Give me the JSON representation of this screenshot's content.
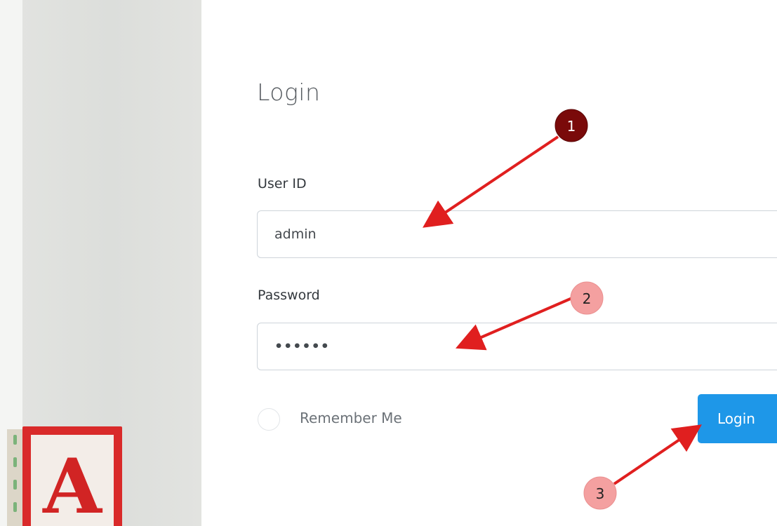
{
  "login": {
    "title": "Login",
    "user_id_label": "User ID",
    "user_id_value": "admin",
    "password_label": "Password",
    "password_mask": "••••••",
    "remember_label": "Remember Me",
    "submit_label": "Login"
  },
  "logo": {
    "letter": "A"
  },
  "annotations": [
    {
      "number": "1",
      "color": "#7a0a0a"
    },
    {
      "number": "2",
      "color": "#f4a0a0"
    },
    {
      "number": "3",
      "color": "#f4a0a0"
    }
  ],
  "colors": {
    "arrow": "#e01f1f",
    "primary_button": "#1e97e8",
    "logo_red": "#d92a2a"
  }
}
